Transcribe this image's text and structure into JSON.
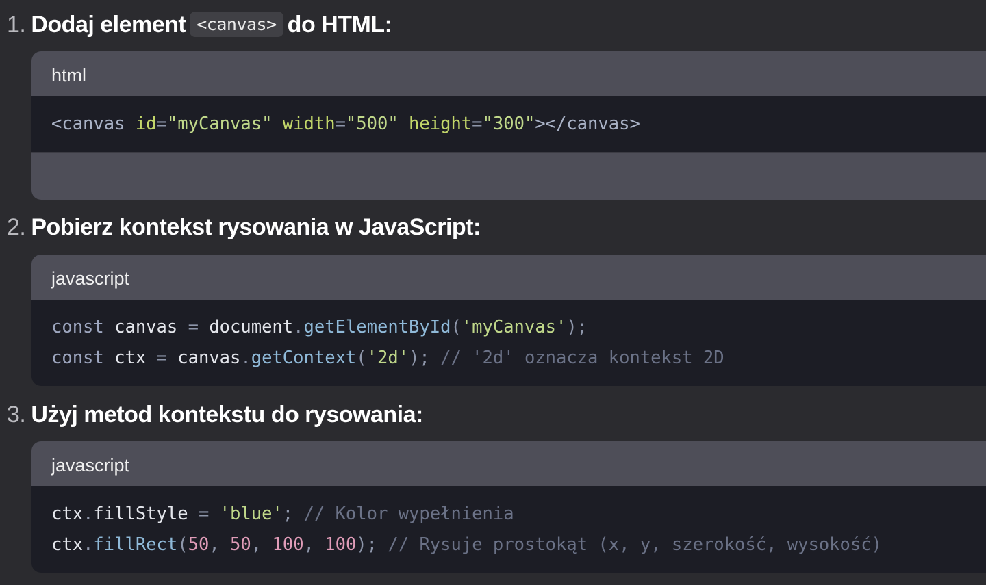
{
  "steps": [
    {
      "number": "1.",
      "title_before": "Dodaj element",
      "inline_code": "<canvas>",
      "title_after": "do HTML:",
      "language": "html",
      "code_lines": [
        [
          [
            "tag",
            "<canvas "
          ],
          [
            "attr",
            "id"
          ],
          [
            "punc",
            "="
          ],
          [
            "str",
            "\"myCanvas\" "
          ],
          [
            "attr",
            "width"
          ],
          [
            "punc",
            "="
          ],
          [
            "str",
            "\"500\" "
          ],
          [
            "attr",
            "height"
          ],
          [
            "punc",
            "="
          ],
          [
            "str",
            "\"300\""
          ],
          [
            "tag",
            "></canvas>"
          ]
        ]
      ]
    },
    {
      "number": "2.",
      "title": "Pobierz kontekst rysowania w JavaScript:",
      "language": "javascript",
      "code_lines": [
        [
          [
            "key",
            "const "
          ],
          [
            "plain",
            "canvas "
          ],
          [
            "punc",
            "= "
          ],
          [
            "plain",
            "document"
          ],
          [
            "punc",
            "."
          ],
          [
            "method",
            "getElementById"
          ],
          [
            "punc",
            "("
          ],
          [
            "str",
            "'myCanvas'"
          ],
          [
            "punc",
            ");"
          ]
        ],
        [
          [
            "key",
            "const "
          ],
          [
            "plain",
            "ctx "
          ],
          [
            "punc",
            "= "
          ],
          [
            "plain",
            "canvas"
          ],
          [
            "punc",
            "."
          ],
          [
            "method",
            "getContext"
          ],
          [
            "punc",
            "("
          ],
          [
            "str",
            "'2d'"
          ],
          [
            "punc",
            "); "
          ],
          [
            "comment",
            "// '2d' oznacza kontekst 2D"
          ]
        ]
      ]
    },
    {
      "number": "3.",
      "title": "Użyj metod kontekstu do rysowania:",
      "language": "javascript",
      "code_lines": [
        [
          [
            "plain",
            "ctx"
          ],
          [
            "punc",
            "."
          ],
          [
            "plain",
            "fillStyle "
          ],
          [
            "punc",
            "= "
          ],
          [
            "str",
            "'blue'"
          ],
          [
            "punc",
            "; "
          ],
          [
            "comment",
            "// Kolor wypełnienia"
          ]
        ],
        [
          [
            "plain",
            "ctx"
          ],
          [
            "punc",
            "."
          ],
          [
            "method",
            "fillRect"
          ],
          [
            "punc",
            "("
          ],
          [
            "num",
            "50"
          ],
          [
            "punc",
            ", "
          ],
          [
            "num",
            "50"
          ],
          [
            "punc",
            ", "
          ],
          [
            "num",
            "100"
          ],
          [
            "punc",
            ", "
          ],
          [
            "num",
            "100"
          ],
          [
            "punc",
            "); "
          ],
          [
            "comment",
            "// Rysuje prostokąt (x, y, szerokość, wysokość)"
          ]
        ]
      ]
    }
  ],
  "colors": {
    "background": "#2b2b2f",
    "code_header": "#4e4e58",
    "code_body": "#1c1d25"
  },
  "icons": {
    "run": "play-icon"
  }
}
